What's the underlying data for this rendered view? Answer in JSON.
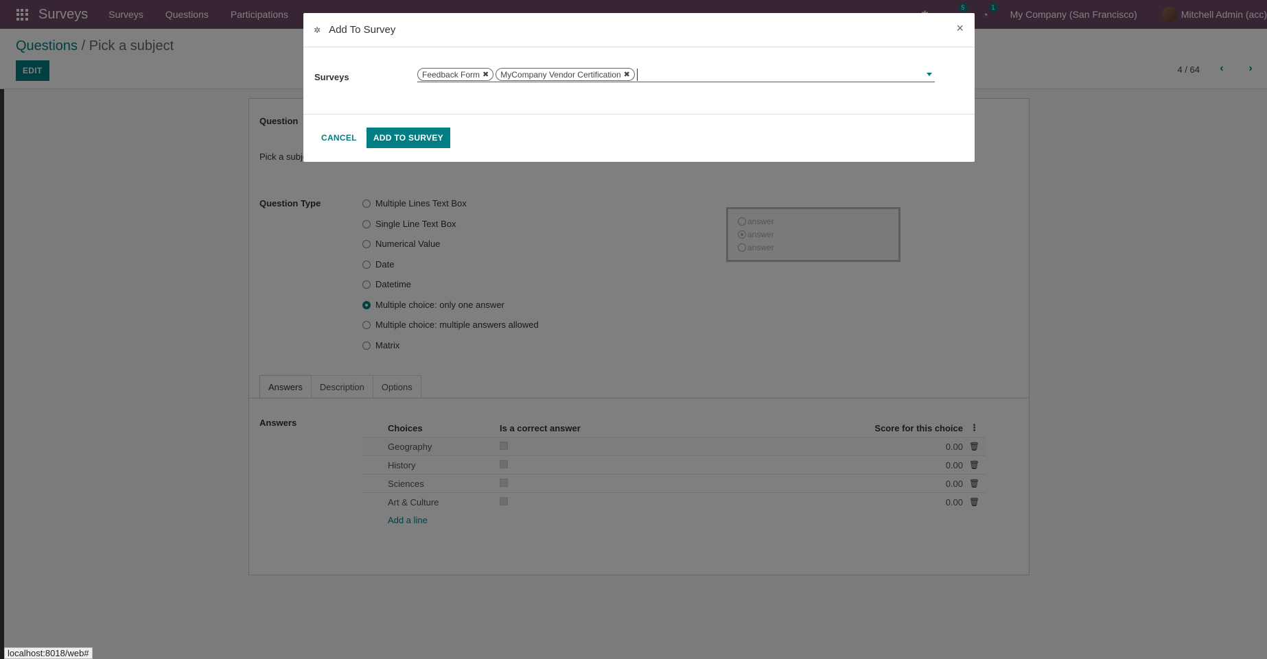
{
  "navbar": {
    "brand": "Surveys",
    "menu": [
      "Surveys",
      "Questions",
      "Participations"
    ],
    "messages_badge": "5",
    "activity_badge": "1",
    "company": "My Company (San Francisco)",
    "user": "Mitchell Admin (acc)"
  },
  "control_panel": {
    "breadcrumb_parent": "Questions",
    "breadcrumb_separator": "/",
    "breadcrumb_current": "Pick a subject",
    "edit_label": "EDIT",
    "pager": "4 / 64"
  },
  "form": {
    "question_label": "Question",
    "question_value": "Pick a subject",
    "question_type_label": "Question Type",
    "question_types": [
      {
        "label": "Multiple Lines Text Box",
        "checked": false
      },
      {
        "label": "Single Line Text Box",
        "checked": false
      },
      {
        "label": "Numerical Value",
        "checked": false
      },
      {
        "label": "Date",
        "checked": false
      },
      {
        "label": "Datetime",
        "checked": false
      },
      {
        "label": "Multiple choice: only one answer",
        "checked": true
      },
      {
        "label": "Multiple choice: multiple answers allowed",
        "checked": false
      },
      {
        "label": "Matrix",
        "checked": false
      }
    ],
    "preview": [
      "answer",
      "answer",
      "answer"
    ],
    "tabs": [
      "Answers",
      "Description",
      "Options"
    ],
    "answers_label": "Answers",
    "table": {
      "headers": [
        "Choices",
        "Is a correct answer",
        "Score for this choice"
      ],
      "rows": [
        {
          "choice": "Geography",
          "score": "0.00"
        },
        {
          "choice": "History",
          "score": "0.00"
        },
        {
          "choice": "Sciences",
          "score": "0.00"
        },
        {
          "choice": "Art & Culture",
          "score": "0.00"
        }
      ],
      "add_line": "Add a line"
    }
  },
  "modal": {
    "title": "Add To Survey",
    "close": "×",
    "surveys_label": "Surveys",
    "tags": [
      "Feedback Form",
      "MyCompany Vendor Certification"
    ],
    "tag_input_value": "",
    "cancel_label": "CANCEL",
    "add_label": "ADD TO SURVEY"
  },
  "status_bar": {
    "url": "localhost:8018/web#"
  },
  "icons": {
    "apps": "apps-grid-icon",
    "bug": "bug-icon",
    "trash": "trash-icon"
  },
  "colors": {
    "navbar": "#714b67",
    "primary": "#017e84"
  }
}
